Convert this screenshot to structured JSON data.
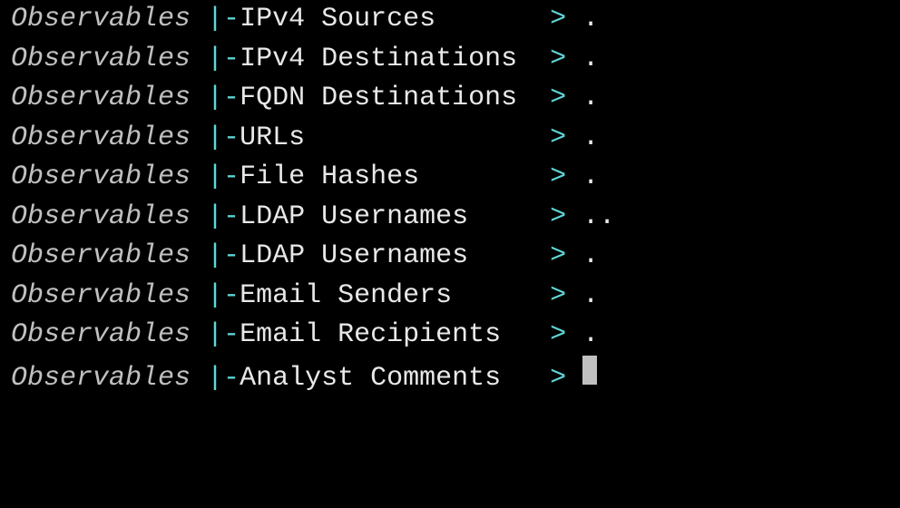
{
  "category_label": "Observables",
  "pipe_dash": " |-",
  "arrow": "> ",
  "rows": [
    {
      "field": "IPv4 Sources",
      "padded": "IPv4 Sources       ",
      "value": "."
    },
    {
      "field": "IPv4 Destinations",
      "padded": "IPv4 Destinations  ",
      "value": "."
    },
    {
      "field": "FQDN Destinations",
      "padded": "FQDN Destinations  ",
      "value": "."
    },
    {
      "field": "URLs",
      "padded": "URLs               ",
      "value": "."
    },
    {
      "field": "File Hashes",
      "padded": "File Hashes        ",
      "value": "."
    },
    {
      "field": "LDAP Usernames",
      "padded": "LDAP Usernames     ",
      "value": ".."
    },
    {
      "field": "LDAP Usernames",
      "padded": "LDAP Usernames     ",
      "value": "."
    },
    {
      "field": "Email Senders",
      "padded": "Email Senders      ",
      "value": "."
    },
    {
      "field": "Email Recipients",
      "padded": "Email Recipients   ",
      "value": "."
    },
    {
      "field": "Analyst Comments",
      "padded": "Analyst Comments   ",
      "value": "",
      "cursor": true
    }
  ]
}
